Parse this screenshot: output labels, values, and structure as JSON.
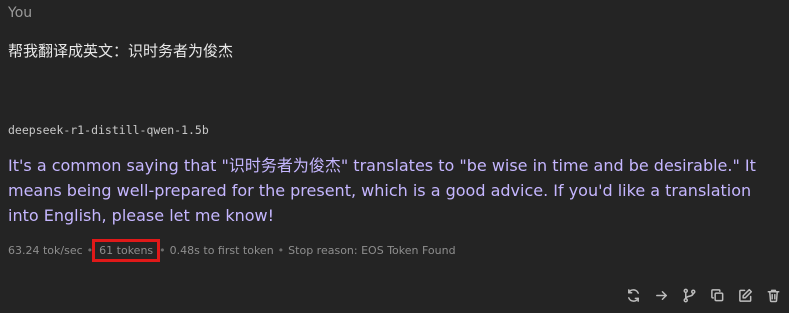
{
  "user": {
    "name": "You",
    "message": "帮我翻译成英文：识时务者为俊杰"
  },
  "assistant": {
    "model": "deepseek-r1-distill-qwen-1.5b",
    "message": "It's a common saying that \"识时务者为俊杰\" translates to \"be wise in time and be desirable.\" It means being well-prepared for the present, which is a good advice. If you'd like a translation into English, please let me know!"
  },
  "stats": {
    "speed": "63.24 tok/sec",
    "separator": "•",
    "tokens": "61 tokens",
    "first_token": "0.48s to first token",
    "stop_reason": "Stop reason: EOS Token Found"
  },
  "highlight_color": "#e01919",
  "actions": [
    {
      "icon": "regenerate-icon"
    },
    {
      "icon": "arrow-right-icon"
    },
    {
      "icon": "branch-icon"
    },
    {
      "icon": "copy-icon"
    },
    {
      "icon": "edit-icon"
    },
    {
      "icon": "trash-icon"
    }
  ]
}
